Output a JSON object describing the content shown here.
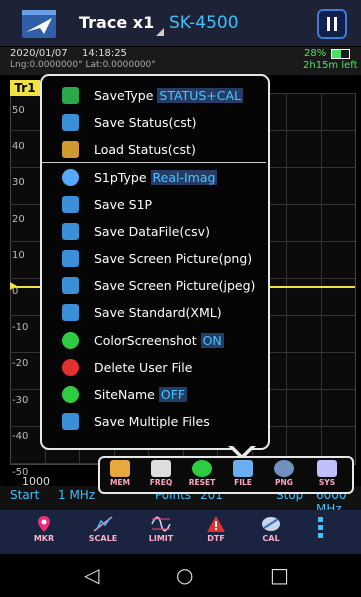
{
  "header": {
    "trace_label": "Trace x1",
    "model": "SK-4500"
  },
  "info": {
    "date": "2020/01/07",
    "time": "14:18:25",
    "coords": "Lng:0.0000000°  Lat:0.0000000°",
    "battery_pct": "28%",
    "time_left": "2h15m left"
  },
  "plot": {
    "trace_tag": "Tr1",
    "y_labels": [
      "50",
      "40",
      "30",
      "20",
      "10",
      "0",
      "-10",
      "-20",
      "-30",
      "-40",
      "-50"
    ],
    "x_start_label": "1000"
  },
  "freq": {
    "start_label": "Start",
    "start_value": "1 MHz",
    "points_label": "Points",
    "points_value": "201",
    "stop_label": "Stop",
    "stop_value": "6000 MHz"
  },
  "menu": {
    "items": [
      {
        "label": "SaveType",
        "value": "STATUS+CAL",
        "icon": "save-type-icon",
        "color": "#2aa84a"
      },
      {
        "label": "Save Status(cst)",
        "value": "",
        "icon": "save-icon",
        "color": "#3a8fd6"
      },
      {
        "label": "Load Status(cst)",
        "value": "",
        "icon": "load-icon",
        "color": "#d09a30"
      },
      {
        "label": "S1pType",
        "value": "Real-Imag",
        "icon": "s1p-type-icon",
        "color": "#55aaff"
      },
      {
        "label": "Save S1P",
        "value": "",
        "icon": "save-icon",
        "color": "#3a8fd6"
      },
      {
        "label": "Save DataFile(csv)",
        "value": "",
        "icon": "save-icon",
        "color": "#3a8fd6"
      },
      {
        "label": "Save Screen Picture(png)",
        "value": "",
        "icon": "save-icon",
        "color": "#3a8fd6"
      },
      {
        "label": "Save Screen Picture(jpeg)",
        "value": "",
        "icon": "save-icon",
        "color": "#3a8fd6"
      },
      {
        "label": "Save Standard(XML)",
        "value": "",
        "icon": "save-icon",
        "color": "#3a8fd6"
      },
      {
        "label": "ColorScreenshot",
        "value": "ON",
        "icon": "toggle-on-icon",
        "color": "#2ecc40"
      },
      {
        "label": "Delete User File",
        "value": "",
        "icon": "delete-icon",
        "color": "#e53030"
      },
      {
        "label": "SiteName",
        "value": "OFF",
        "icon": "toggle-on-icon",
        "color": "#2ecc40"
      },
      {
        "label": "Save Multiple Files",
        "value": "",
        "icon": "save-icon",
        "color": "#3a8fd6"
      }
    ]
  },
  "subtoolbar": {
    "items": [
      {
        "label": "MEM",
        "icon": "memory-icon"
      },
      {
        "label": "FREQ",
        "icon": "frequency-icon"
      },
      {
        "label": "RESET",
        "icon": "reset-icon"
      },
      {
        "label": "FILE",
        "icon": "file-icon"
      },
      {
        "label": "PNG",
        "icon": "png-icon"
      },
      {
        "label": "SYS",
        "icon": "system-icon"
      }
    ]
  },
  "toolbar": {
    "items": [
      {
        "label": "MKR",
        "icon": "marker-icon"
      },
      {
        "label": "SCALE",
        "icon": "scale-icon"
      },
      {
        "label": "LIMIT",
        "icon": "limit-icon"
      },
      {
        "label": "DTF",
        "icon": "dtf-icon"
      },
      {
        "label": "CAL",
        "icon": "calibration-icon"
      }
    ]
  },
  "colors": {
    "accent": "#3ec0ff",
    "trace": "#f0e240",
    "header_bg": "#1d2236",
    "battery": "#4de066"
  }
}
